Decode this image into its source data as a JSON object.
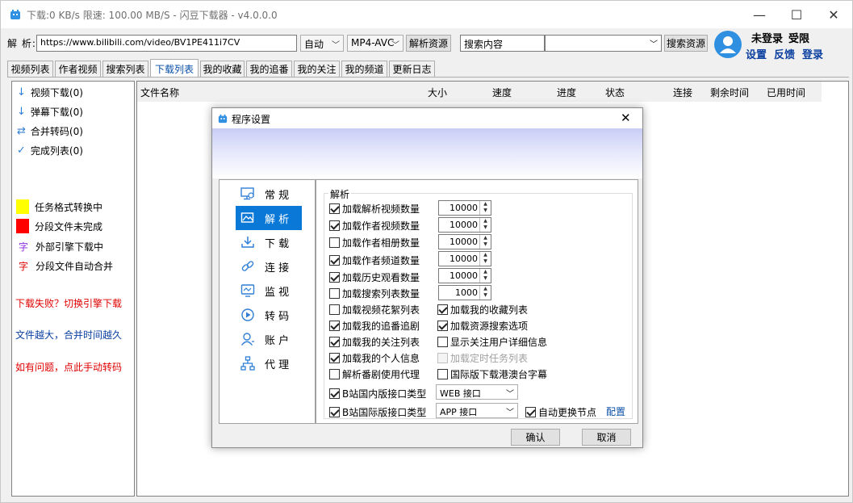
{
  "app": {
    "title": "下载:0 KB/s  限速: 100.00 MB/S  - 闪豆下载器 - v4.0.0.0",
    "window_buttons": {
      "minimize": "—",
      "maximize": "☐",
      "close": "✕"
    }
  },
  "toolbar": {
    "url_label": "解 析:",
    "url_value": "https://www.bilibili.com/video/BV1PE411i7CV",
    "mode_select": "自动",
    "codec_select": "MP4-AVC",
    "parse_button": "解析资源",
    "search_input": "搜索内容",
    "search_select": "",
    "search_button": "搜索资源"
  },
  "user": {
    "status": "未登录",
    "limit": "受限",
    "links": [
      "设置",
      "反馈",
      "登录"
    ],
    "link_color": "#0a3fa0"
  },
  "tabs": [
    {
      "label": "视频列表",
      "active": false
    },
    {
      "label": "作者视频",
      "active": false
    },
    {
      "label": "搜索列表",
      "active": false
    },
    {
      "label": "下载列表",
      "active": true
    },
    {
      "label": "我的收藏",
      "active": false
    },
    {
      "label": "我的追番",
      "active": false
    },
    {
      "label": "我的关注",
      "active": false
    },
    {
      "label": "我的频道",
      "active": false
    },
    {
      "label": "更新日志",
      "active": false
    }
  ],
  "left_panel": {
    "items": [
      {
        "icon": "arrow-down-icon",
        "label": "视频下载(0)"
      },
      {
        "icon": "arrow-down-icon",
        "label": "弹幕下载(0)"
      },
      {
        "icon": "merge-icon",
        "label": "合并转码(0)"
      },
      {
        "icon": "check-icon",
        "label": "完成列表(0)"
      }
    ],
    "legend": [
      {
        "color": "#ffff00",
        "label": "任务格式转换中",
        "mark": ""
      },
      {
        "color": "#ff0000",
        "label": "分段文件未完成",
        "mark": ""
      },
      {
        "color": "#8a2be2",
        "label": "外部引擎下载中",
        "mark": "字"
      },
      {
        "color": "#e00000",
        "label": "分段文件自动合并",
        "mark": "字"
      }
    ],
    "hints": [
      {
        "text": "下载失败？切换引擎下载",
        "color": "#e00000"
      },
      {
        "text": "文件越大，合并时间越久",
        "color": "#0a3fa0"
      },
      {
        "text": "如有问题，点此手动转码",
        "color": "#e00000"
      }
    ]
  },
  "download_table": {
    "columns": [
      "文件名称",
      "大小",
      "速度",
      "进度",
      "状态",
      "连接",
      "剩余时间",
      "已用时间"
    ]
  },
  "dialog": {
    "title": "程序设置",
    "close": "✕",
    "nav": [
      {
        "icon": "settings-monitor-icon",
        "label": "常 规",
        "active": false
      },
      {
        "icon": "image-icon",
        "label": "解 析",
        "active": true
      },
      {
        "icon": "download-icon",
        "label": "下 载",
        "active": false
      },
      {
        "icon": "link-icon",
        "label": "连 接",
        "active": false
      },
      {
        "icon": "monitor-icon",
        "label": "监 视",
        "active": false
      },
      {
        "icon": "play-circle-icon",
        "label": "转 码",
        "active": false
      },
      {
        "icon": "user-icon",
        "label": "账 户",
        "active": false
      },
      {
        "icon": "network-icon",
        "label": "代 理",
        "active": false
      }
    ],
    "group_title": "解析",
    "count_options": [
      {
        "label": "加载解析视频数量",
        "checked": true,
        "value": "10000"
      },
      {
        "label": "加载作者视频数量",
        "checked": true,
        "value": "10000"
      },
      {
        "label": "加载作者相册数量",
        "checked": false,
        "value": "10000"
      },
      {
        "label": "加载作者频道数量",
        "checked": true,
        "value": "10000"
      },
      {
        "label": "加载历史观看数量",
        "checked": true,
        "value": "10000"
      },
      {
        "label": "加载搜索列表数量",
        "checked": false,
        "value": "1000"
      }
    ],
    "left_options": [
      {
        "label": "加载视频花絮列表",
        "checked": false
      },
      {
        "label": "加载我的追番追剧",
        "checked": true
      },
      {
        "label": "加载我的关注列表",
        "checked": true
      },
      {
        "label": "加载我的个人信息",
        "checked": true
      },
      {
        "label": "解析番剧使用代理",
        "checked": false
      }
    ],
    "right_options": [
      {
        "label": "加载我的收藏列表",
        "checked": true,
        "disabled": false
      },
      {
        "label": "加载资源搜索选项",
        "checked": true,
        "disabled": false
      },
      {
        "label": "显示关注用户详细信息",
        "checked": false,
        "disabled": false
      },
      {
        "label": "加载定时任务列表",
        "checked": false,
        "disabled": true
      },
      {
        "label": "国际版下载港澳台字幕",
        "checked": false,
        "disabled": false
      }
    ],
    "api_domestic": {
      "label": "B站国内版接口类型",
      "checked": true,
      "value": "WEB 接口"
    },
    "api_intl": {
      "label": "B站国际版接口类型",
      "checked": true,
      "value": "APP 接口"
    },
    "auto_switch": {
      "label": "自动更换节点",
      "checked": true
    },
    "config_link": "配置",
    "ok": "确认",
    "cancel": "取消"
  }
}
